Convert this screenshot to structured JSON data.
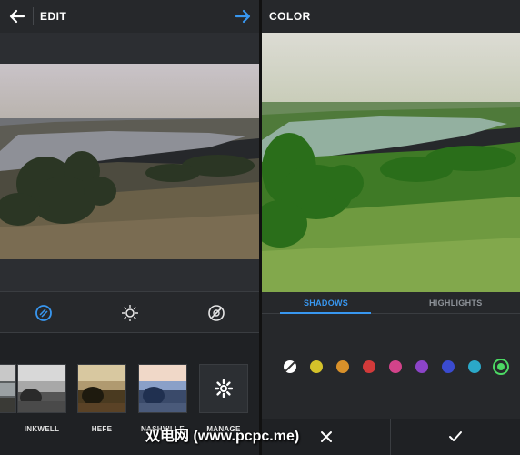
{
  "left_panel": {
    "title": "EDIT",
    "filters": [
      {
        "label": ""
      },
      {
        "label": "INKWELL"
      },
      {
        "label": "HEFE"
      },
      {
        "label": "NASHVILLE"
      },
      {
        "label": "MANAGE"
      }
    ],
    "tools": [
      "filter-icon",
      "brightness-icon",
      "adjust-icon"
    ]
  },
  "right_panel": {
    "title": "COLOR",
    "tabs": {
      "shadows": "SHADOWS",
      "highlights": "HIGHLIGHTS",
      "active": "SHADOWS"
    },
    "colors": [
      "#ffffff",
      "#d4c22a",
      "#d9912a",
      "#d23a3a",
      "#d2438a",
      "#8c44c8",
      "#3a4bd0",
      "#2ba8c8",
      "#4cd964"
    ],
    "selected_color": "#4cd964"
  },
  "accent_color": "#3897f0",
  "watermark": "双电网 (www.pcpc.me)"
}
